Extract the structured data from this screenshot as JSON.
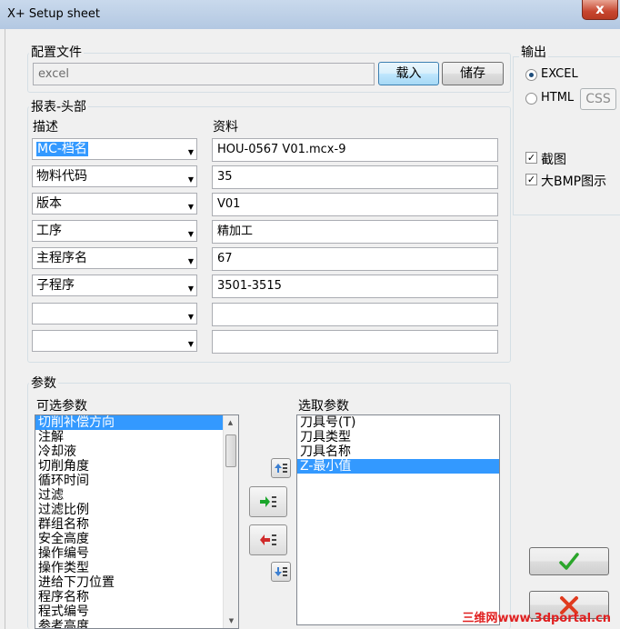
{
  "window": {
    "title": "X+ Setup sheet",
    "close_label": "x"
  },
  "config": {
    "label": "配置文件",
    "value": "excel",
    "load_label": "载入",
    "save_label": "储存"
  },
  "header_group": {
    "label": "报表-头部",
    "desc_label": "描述",
    "data_label": "资料",
    "rows": [
      {
        "desc": "MC-档名",
        "value": "HOU-0567 V01.mcx-9"
      },
      {
        "desc": "物料代码",
        "value": "35"
      },
      {
        "desc": "版本",
        "value": "V01"
      },
      {
        "desc": "工序",
        "value": "精加工"
      },
      {
        "desc": "主程序名",
        "value": "67"
      },
      {
        "desc": "子程序",
        "value": "3501-3515"
      },
      {
        "desc": "",
        "value": ""
      },
      {
        "desc": "",
        "value": ""
      }
    ]
  },
  "output": {
    "label": "输出",
    "excel_label": "EXCEL",
    "html_label": "HTML",
    "css_label": "CSS",
    "screenshot_label": "截图",
    "bmp_label": "大BMP图示",
    "check_mark": "✓"
  },
  "params": {
    "label": "参数",
    "available_label": "可选参数",
    "selected_label": "选取参数",
    "available": [
      "切削补偿方向",
      "注解",
      "冷却液",
      "切削角度",
      "循环时间",
      "过滤",
      "过滤比例",
      "群组名称",
      "安全高度",
      "操作编号",
      "操作类型",
      "进给下刀位置",
      "程序名称",
      "程式编号",
      "参考高度"
    ],
    "selected": [
      "刀具号(T)",
      "刀具类型",
      "刀具名称",
      "Z-最小值"
    ]
  },
  "watermark": "三维网www.3dportal.cn",
  "colors": {
    "selection": "#3399ff",
    "ok_green": "#2aa52a",
    "cancel_red": "#e03a1e"
  }
}
